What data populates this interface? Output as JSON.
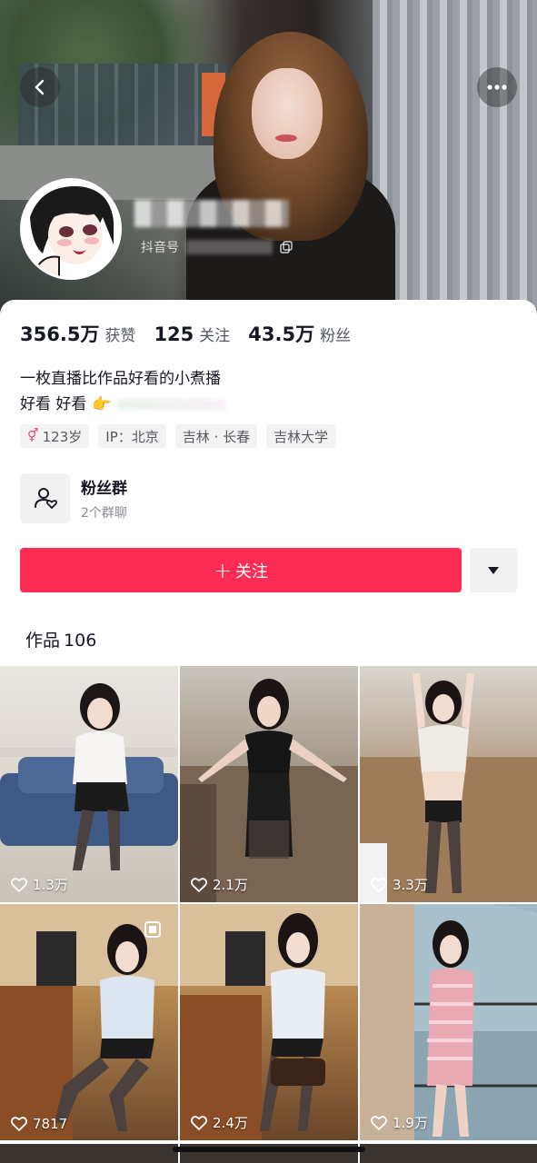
{
  "header": {
    "douyin_id_label": "抖音号"
  },
  "stats": [
    {
      "value": "356.5万",
      "label": "获赞"
    },
    {
      "value": "125",
      "label": "关注"
    },
    {
      "value": "43.5万",
      "label": "粉丝"
    }
  ],
  "bio": {
    "line1": "一枚直播比作品好看的小煮播",
    "line2": "好看 好看",
    "emoji": "👉"
  },
  "tags": [
    {
      "gender_symbol": "⚥",
      "text": "123岁"
    },
    {
      "text": "IP：北京"
    },
    {
      "text": "吉林 · 长春"
    },
    {
      "text": "吉林大学"
    }
  ],
  "fans_group": {
    "title": "粉丝群",
    "subtitle": "2个群聊"
  },
  "follow_button": {
    "plus": "+",
    "label": "关注"
  },
  "works": {
    "label": "作品",
    "count": "106"
  },
  "videos": [
    {
      "likes": "1.3万"
    },
    {
      "likes": "2.1万"
    },
    {
      "likes": "3.3万"
    },
    {
      "likes": "7817"
    },
    {
      "likes": "2.4万"
    },
    {
      "likes": "1.9万"
    }
  ],
  "colors": {
    "accent": "#fe2c55",
    "text_primary": "#161823",
    "text_secondary": "#555a61",
    "tag_bg": "#f3f3f4"
  }
}
